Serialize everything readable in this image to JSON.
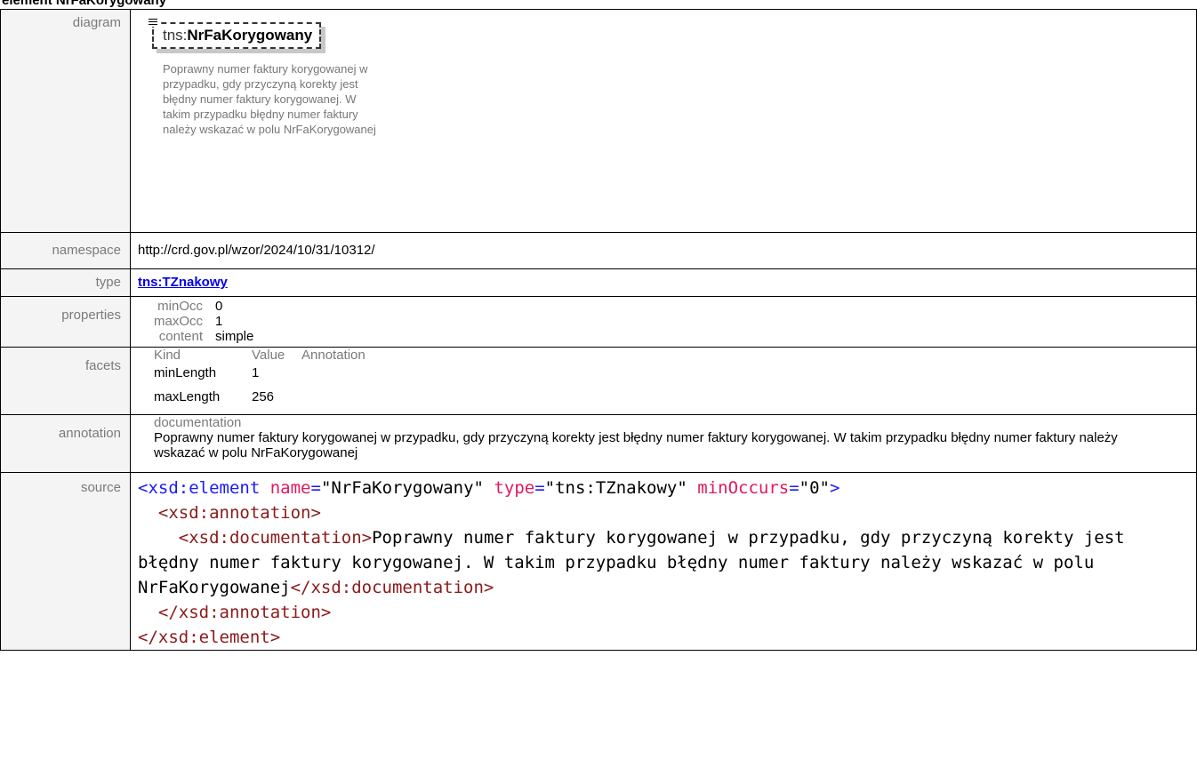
{
  "page_title": "element NrFaKorygowany",
  "labels": {
    "diagram": "diagram",
    "namespace": "namespace",
    "type": "type",
    "properties": "properties",
    "facets": "facets",
    "annotation": "annotation",
    "source": "source"
  },
  "diagram": {
    "prefix": "tns:",
    "name": "NrFaKorygowany",
    "doc": "Poprawny numer faktury korygowanej w przypadku, gdy przyczyną korekty jest błędny numer faktury korygowanej. W takim przypadku błędny numer faktury należy wskazać w polu NrFaKorygowanej"
  },
  "namespace": "http://crd.gov.pl/wzor/2024/10/31/10312/",
  "type": "tns:TZnakowy",
  "properties": [
    {
      "key": "minOcc",
      "value": "0"
    },
    {
      "key": "maxOcc",
      "value": "1"
    },
    {
      "key": "content",
      "value": "simple"
    }
  ],
  "facets": {
    "headers": [
      "Kind",
      "Value",
      "Annotation"
    ],
    "rows": [
      {
        "kind": "minLength",
        "value": "1"
      },
      {
        "kind": "maxLength",
        "value": "256"
      }
    ]
  },
  "annotation": {
    "label": "documentation",
    "text": "Poprawny numer faktury korygowanej w przypadku, gdy przyczyną korekty jest błędny numer faktury korygowanej. W takim przypadku błędny numer faktury należy wskazać w polu NrFaKorygowanej"
  },
  "source": {
    "open_tag": "<xsd:element",
    "attr_name": "name",
    "attr_name_val": "\"NrFaKorygowany\"",
    "attr_type": "type",
    "attr_type_val": "\"tns:TZnakowy\"",
    "attr_min": "minOccurs",
    "attr_min_val": "\"0\"",
    "close_gt": ">",
    "ann_open": "<xsd:annotation>",
    "doc_open": "<xsd:documentation>",
    "doc_text": "Poprawny numer faktury korygowanej w przypadku, gdy przyczyną korekty jest błędny numer faktury korygowanej. W takim przypadku błędny numer faktury należy wskazać w polu NrFaKorygowanej",
    "doc_close": "</xsd:documentation>",
    "ann_close": "</xsd:annotation>",
    "elem_close": "</xsd:element>"
  }
}
